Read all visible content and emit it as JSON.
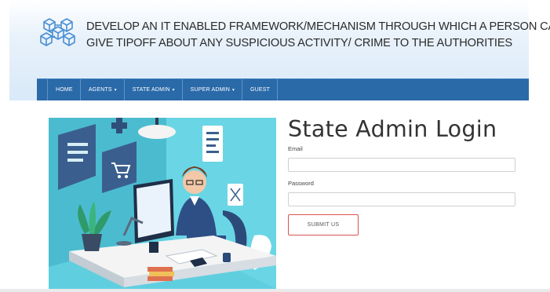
{
  "header": {
    "title_line1": "DEVELOP AN IT ENABLED FRAMEWORK/MECHANISM THROUGH WHICH A PERSON CAN",
    "title_line2": "GIVE TIPOFF ABOUT ANY SUSPICIOUS ACTIVITY/ CRIME TO THE AUTHORITIES",
    "logo_icon": "connected-cubes-icon"
  },
  "nav": {
    "items": [
      {
        "label": "HOME",
        "dropdown": false
      },
      {
        "label": "AGENTS",
        "dropdown": true
      },
      {
        "label": "STATE ADMIN",
        "dropdown": true
      },
      {
        "label": "SUPER ADMIN",
        "dropdown": true
      },
      {
        "label": "GUEST",
        "dropdown": false
      }
    ],
    "caret": "▾"
  },
  "login": {
    "title": "State Admin Login",
    "email_label": "Email",
    "email_value": "",
    "password_label": "Password",
    "password_value": "",
    "submit_label": "SUBMIT US"
  },
  "colors": {
    "nav_bg": "#2a6aa9",
    "submit_border": "#d9534f",
    "logo": "#4a8fd3",
    "illustration_bg": "#5fcfe0"
  }
}
